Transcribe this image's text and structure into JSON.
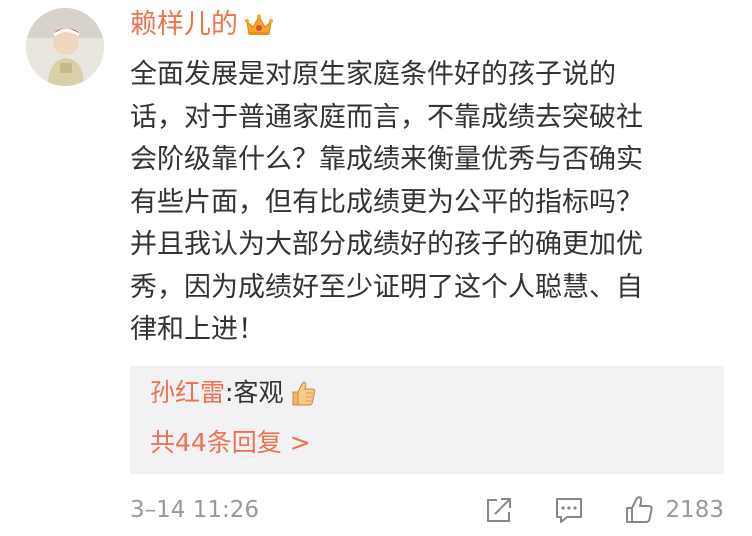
{
  "comment": {
    "author": "赖样儿的",
    "text": "全面发展是对原生家庭条件好的孩子说的\n话，对于普通家庭而言，不靠成绩去突破社\n会阶级靠什么？靠成绩来衡量优秀与否确实\n有些片面，但有比成绩更为公平的指标吗？\n并且我认为大部分成绩好的孩子的确更加优\n秀，因为成绩好至少证明了这个人聪慧、自\n律和上进！",
    "badge_icon": "crown-icon",
    "avatar_icon": "avatar-photo"
  },
  "reply": {
    "author": "孙红雷",
    "separator": ": ",
    "text": "客观",
    "emoji_icon": "thumbs-up-emoji",
    "count_label": "共44条回复 >"
  },
  "footer": {
    "timestamp": "3–14 11:26",
    "like_count": "2183",
    "icons": [
      "share-icon",
      "comment-icon",
      "like-icon"
    ]
  },
  "colors": {
    "username": "#eb7350",
    "text": "#333333",
    "meta": "#999999",
    "reply_bg": "#f2f2f5"
  }
}
